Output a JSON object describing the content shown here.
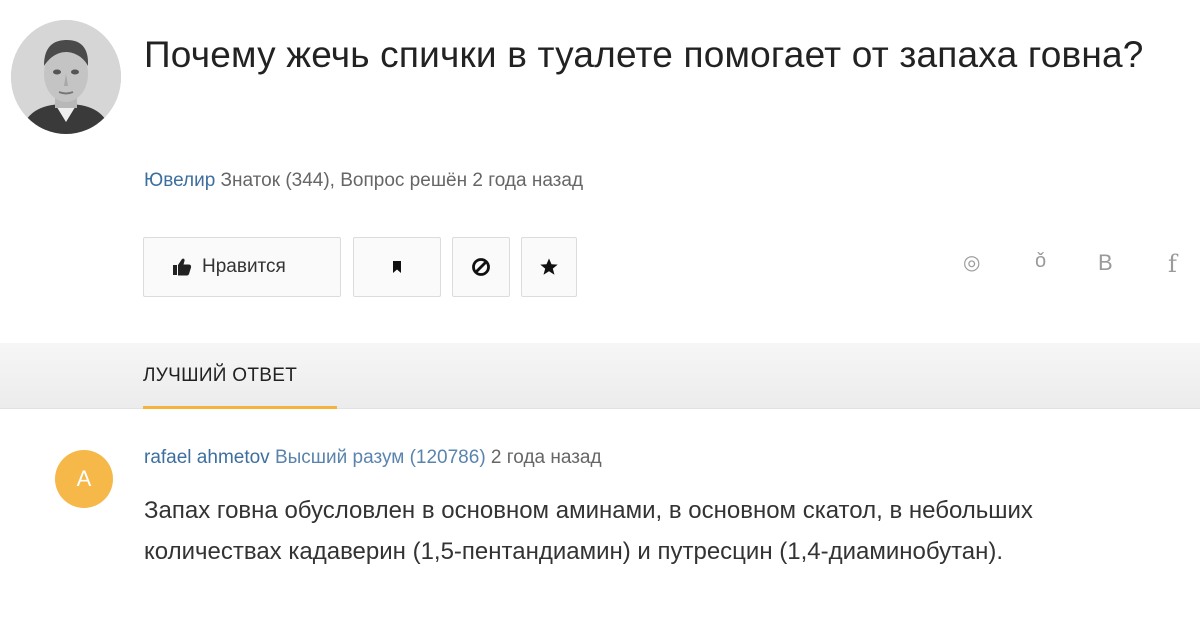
{
  "question": {
    "title": "Почему жечь спички в туалете помогает от запаха говна?",
    "author": "Ювелир",
    "meta": " Знаток (344), Вопрос решён 2 года назад"
  },
  "actions": {
    "like_label": "Нравится",
    "icons": [
      "like-icon",
      "bookmark-icon",
      "block-icon",
      "star-icon"
    ]
  },
  "share": {
    "icons": [
      "ok-ru-share-icon",
      "odnoklassniki-share-icon",
      "vk-share-icon",
      "facebook-share-icon"
    ],
    "ok_glyph": "◎",
    "odn_glyph": "ǒ",
    "vk_glyph": "В",
    "fb_glyph": "f"
  },
  "best_answer": {
    "tab_label": "ЛУЧШИЙ ОТВЕТ"
  },
  "answer": {
    "avatar_letter": "A",
    "author": "rafael ahmetov",
    "rank": " Высший разум (120786)",
    "time": " 2 года назад",
    "text": "Запах говна обусловлен в основном аминами, в основном скатол, в небольших количествах кадаверин (1,5-пентандиамин) и путресцин (1,4-диаминобутан)."
  },
  "colors": {
    "accent_underline": "#f3b33e",
    "link_blue": "#3d6f9e",
    "avatar_orange": "#f7b84a"
  }
}
